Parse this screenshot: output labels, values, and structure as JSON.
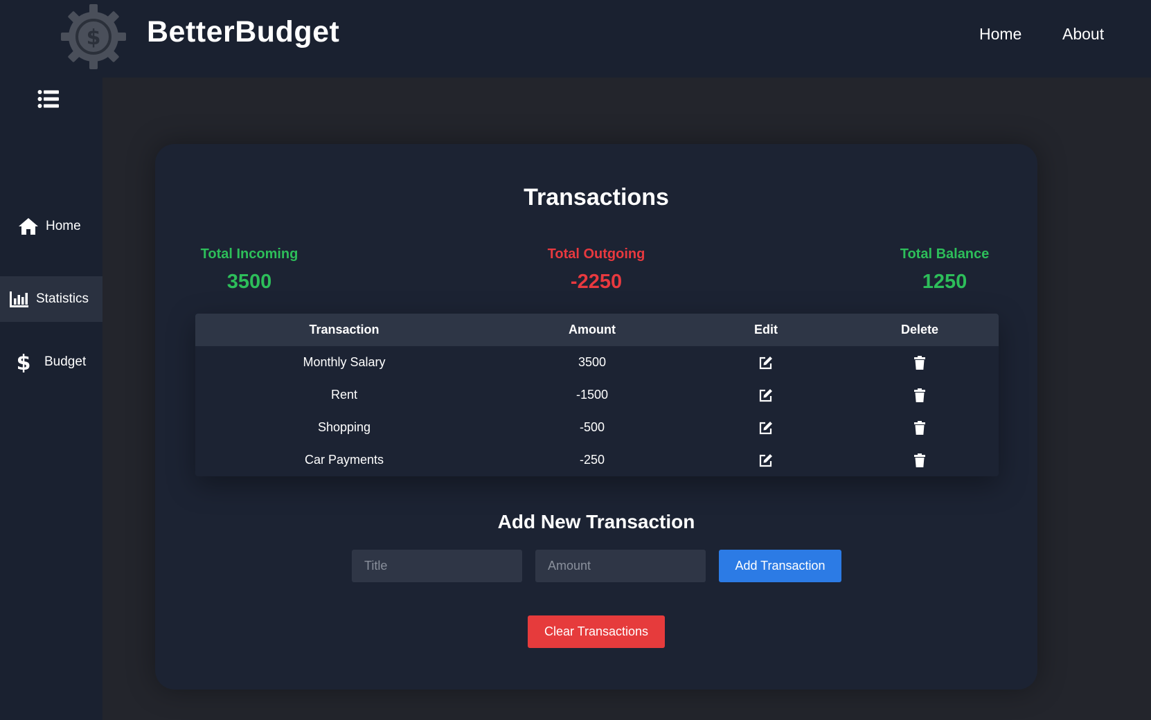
{
  "header": {
    "brand": "BetterBudget",
    "nav": [
      "Home",
      "About"
    ],
    "logo_icon": "dollar-gear-icon"
  },
  "sidebar": {
    "toggle_icon": "list-menu-icon",
    "items": [
      {
        "label": "Home",
        "icon": "home-icon",
        "active": false
      },
      {
        "label": "Statistics",
        "icon": "bar-chart-icon",
        "active": true
      },
      {
        "label": "Budget",
        "icon": "dollar-icon",
        "active": false
      }
    ]
  },
  "main": {
    "title": "Transactions",
    "summary": {
      "incoming_label": "Total Incoming",
      "incoming_value": "3500",
      "outgoing_label": "Total Outgoing",
      "outgoing_value": "-2250",
      "balance_label": "Total Balance",
      "balance_value": "1250"
    },
    "table": {
      "headers": [
        "Transaction",
        "Amount",
        "Edit",
        "Delete"
      ],
      "rows": [
        {
          "title": "Monthly Salary",
          "amount": "3500",
          "positive": true
        },
        {
          "title": "Rent",
          "amount": "-1500",
          "positive": false
        },
        {
          "title": "Shopping",
          "amount": "-500",
          "positive": false
        },
        {
          "title": "Car Payments",
          "amount": "-250",
          "positive": false
        }
      ]
    },
    "add": {
      "title": "Add New Transaction",
      "title_placeholder": "Title",
      "amount_placeholder": "Amount",
      "add_label": "Add Transaction",
      "clear_label": "Clear Transactions"
    }
  },
  "colors": {
    "positive": "#2dbe5a",
    "negative": "#e8393f",
    "accent": "#2c7be5",
    "danger": "#e63b3c"
  }
}
